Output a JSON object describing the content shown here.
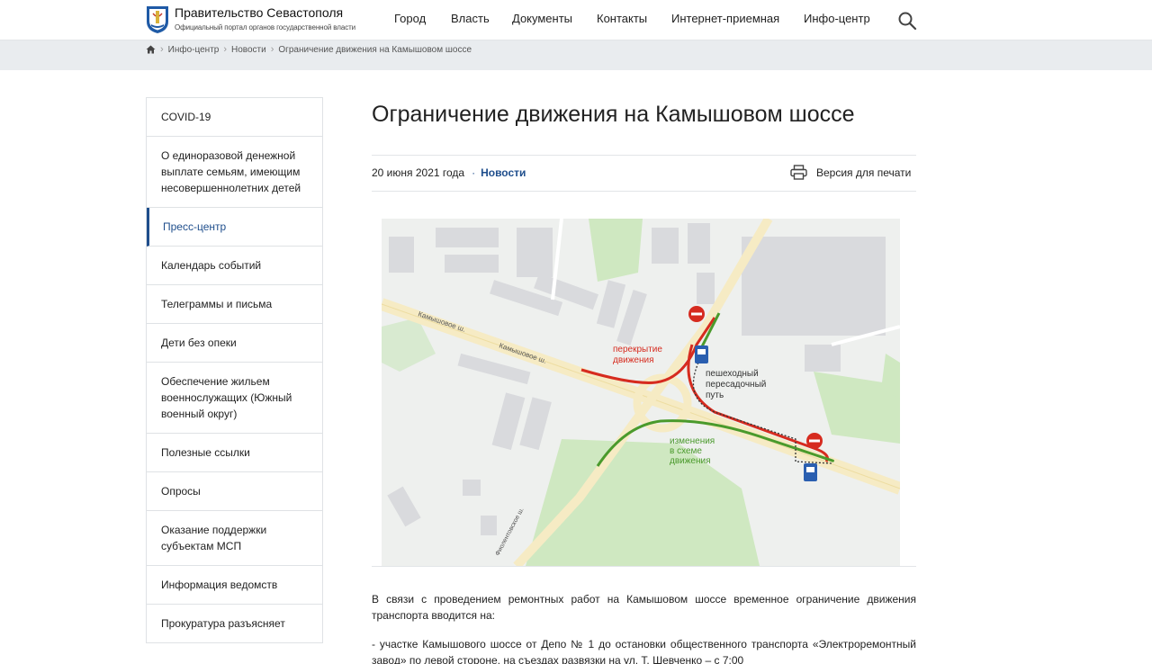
{
  "header": {
    "site_title": "Правительство Севастополя",
    "site_subtitle": "Официальный портал органов государственной власти",
    "nav": [
      "Город",
      "Власть",
      "Документы",
      "Контакты",
      "Интернет-приемная",
      "Инфо-центр"
    ],
    "search_icon": "search-icon"
  },
  "breadcrumb": [
    "Инфо-центр",
    "Новости",
    "Ограничение движения на Камышовом шоссе"
  ],
  "sidebar": {
    "items": [
      {
        "label": "COVID-19"
      },
      {
        "label": "О единоразовой денежной выплате семьям, имеющим несовершеннолетних детей"
      },
      {
        "label": "Пресс-центр",
        "active": true
      },
      {
        "label": "Календарь событий"
      },
      {
        "label": "Телеграммы и письма"
      },
      {
        "label": "Дети без опеки"
      },
      {
        "label": "Обеспечение жильем военнослужащих (Южный военный округ)"
      },
      {
        "label": "Полезные ссылки"
      },
      {
        "label": "Опросы"
      },
      {
        "label": "Оказание поддержки субъектам МСП"
      },
      {
        "label": "Информация ведомств"
      },
      {
        "label": "Прокуратура разъясняет"
      }
    ]
  },
  "article": {
    "title": "Ограничение движения на Камышовом шоссе",
    "date": "20 июня 2021 года",
    "category": "Новости",
    "print_label": "Версия для печати",
    "paragraphs": [
      "В связи с проведением ремонтных работ на Камышовом шоссе временное ограничение движения транспорта вводится на:",
      "- участке Камышового шоссе от Депо №  1 до остановки общественного транспорта «Электроремонтный завод» по левой стороне, на съездах развязки на ул. Т. Шевченко – с 7:00"
    ]
  },
  "map": {
    "road_labels": [
      "Камышовое ш.",
      "Камышовое ш.",
      "Фиолентовское ш."
    ],
    "legend_closure": "перекрытие движения",
    "legend_pedestrian": "пешеходный пересадочный путь",
    "legend_change": "изменения в схеме движения",
    "colors": {
      "closure": "#d62b1f",
      "change": "#4a9a2c",
      "road": "#f6ebc4",
      "park": "#cfe8c1"
    }
  }
}
